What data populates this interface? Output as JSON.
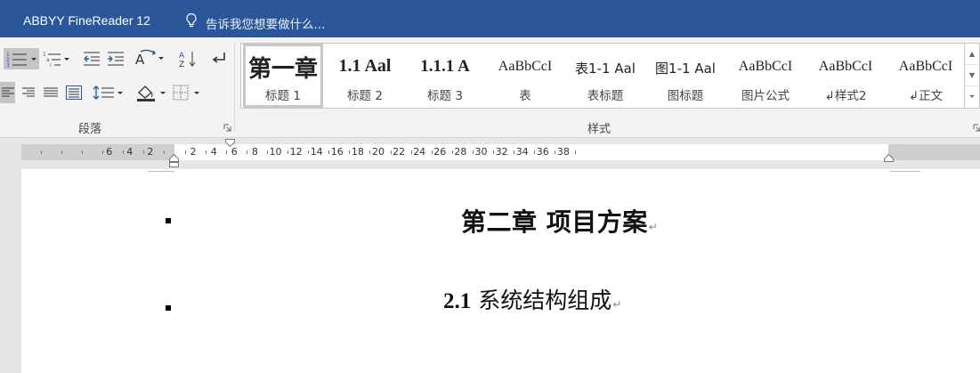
{
  "app": {
    "tab_title": "ABBYY FineReader 12",
    "tell_me": "告诉我您想要做什么..."
  },
  "ribbon": {
    "paragraph_group_label": "段落",
    "styles_group_label": "样式",
    "styles": [
      {
        "preview": "第一章",
        "name": "标题 1",
        "selected": true
      },
      {
        "preview": "1.1 Aal",
        "name": "标题 2"
      },
      {
        "preview": "1.1.1 A",
        "name": "标题 3"
      },
      {
        "preview": "AaBbCcI",
        "name": "表"
      },
      {
        "preview": "表1-1 Aal",
        "name": "表标题"
      },
      {
        "preview": "图1-1 Aal",
        "name": "图标题"
      },
      {
        "preview": "AaBbCcI",
        "name": "图片公式"
      },
      {
        "preview": "AaBbCcI",
        "name": "↲样式2"
      },
      {
        "preview": "AaBbCcI",
        "name": "↲正文"
      }
    ]
  },
  "ruler": {
    "left_numbers": [
      "6",
      "4",
      "2"
    ],
    "numbers": [
      "2",
      "4",
      "6",
      "8",
      "10",
      "12",
      "14",
      "16",
      "18",
      "20",
      "22",
      "24",
      "26",
      "28",
      "30",
      "32",
      "34"
    ],
    "right_numbers": [
      "36",
      "38"
    ]
  },
  "document": {
    "heading1": "第二章 项目方案",
    "heading2_number": "2.1",
    "heading2_text": "系统结构组成",
    "paragraph_mark": "↵"
  }
}
